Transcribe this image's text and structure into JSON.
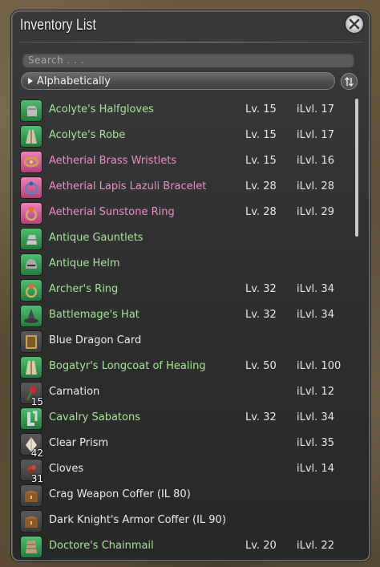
{
  "window": {
    "title": "Inventory List"
  },
  "search": {
    "placeholder": "Search . . ."
  },
  "sort": {
    "label": "Alphabetically"
  },
  "colors": {
    "green": "#a6e39a",
    "pink": "#e98fc3",
    "white": "#ececec",
    "icon_green": "#3aa35c",
    "icon_pink": "#d75a9e",
    "icon_gray": "#4b4b4b"
  },
  "items": [
    {
      "name": "Acolyte's Halfgloves",
      "level": "Lv. 15",
      "ilvl": "iLvl. 17",
      "color": "green",
      "icon": "gloves-icon",
      "quantity": ""
    },
    {
      "name": "Acolyte's Robe",
      "level": "Lv. 15",
      "ilvl": "iLvl. 17",
      "color": "green",
      "icon": "robe-icon",
      "quantity": ""
    },
    {
      "name": "Aetherial Brass Wristlets",
      "level": "Lv. 15",
      "ilvl": "iLvl. 16",
      "color": "pink",
      "icon": "wristlets-icon",
      "quantity": ""
    },
    {
      "name": "Aetherial Lapis Lazuli Bracelet",
      "level": "Lv. 28",
      "ilvl": "iLvl. 28",
      "color": "pink",
      "icon": "bracelet-icon",
      "quantity": ""
    },
    {
      "name": "Aetherial Sunstone Ring",
      "level": "Lv. 28",
      "ilvl": "iLvl. 29",
      "color": "pink",
      "icon": "ring-icon",
      "quantity": ""
    },
    {
      "name": "Antique Gauntlets",
      "level": "",
      "ilvl": "",
      "color": "green",
      "icon": "gauntlets-icon",
      "quantity": ""
    },
    {
      "name": "Antique Helm",
      "level": "",
      "ilvl": "",
      "color": "green",
      "icon": "helm-icon",
      "quantity": ""
    },
    {
      "name": "Archer's Ring",
      "level": "Lv. 32",
      "ilvl": "iLvl. 34",
      "color": "green",
      "icon": "ring-icon",
      "quantity": ""
    },
    {
      "name": "Battlemage's Hat",
      "level": "Lv. 32",
      "ilvl": "iLvl. 34",
      "color": "green",
      "icon": "hat-icon",
      "quantity": ""
    },
    {
      "name": "Blue Dragon Card",
      "level": "",
      "ilvl": "",
      "color": "white",
      "icon": "card-icon",
      "quantity": ""
    },
    {
      "name": "Bogatyr's Longcoat of Healing",
      "level": "Lv. 50",
      "ilvl": "iLvl. 100",
      "color": "green",
      "icon": "coat-icon",
      "quantity": ""
    },
    {
      "name": "Carnation",
      "level": "",
      "ilvl": "iLvl. 12",
      "color": "white",
      "icon": "flower-icon",
      "quantity": "15"
    },
    {
      "name": "Cavalry Sabatons",
      "level": "Lv. 32",
      "ilvl": "iLvl. 34",
      "color": "green",
      "icon": "boots-icon",
      "quantity": ""
    },
    {
      "name": "Clear Prism",
      "level": "",
      "ilvl": "iLvl. 35",
      "color": "white",
      "icon": "prism-icon",
      "quantity": "42"
    },
    {
      "name": "Cloves",
      "level": "",
      "ilvl": "iLvl. 14",
      "color": "white",
      "icon": "cloves-icon",
      "quantity": "31"
    },
    {
      "name": "Crag Weapon Coffer (IL 80)",
      "level": "",
      "ilvl": "",
      "color": "white",
      "icon": "coffer-icon",
      "quantity": ""
    },
    {
      "name": "Dark Knight's Armor Coffer (IL 90)",
      "level": "",
      "ilvl": "",
      "color": "white",
      "icon": "coffer-icon",
      "quantity": ""
    },
    {
      "name": "Doctore's Chainmail",
      "level": "Lv. 20",
      "ilvl": "iLvl. 22",
      "color": "green",
      "icon": "chainmail-icon",
      "quantity": ""
    }
  ]
}
